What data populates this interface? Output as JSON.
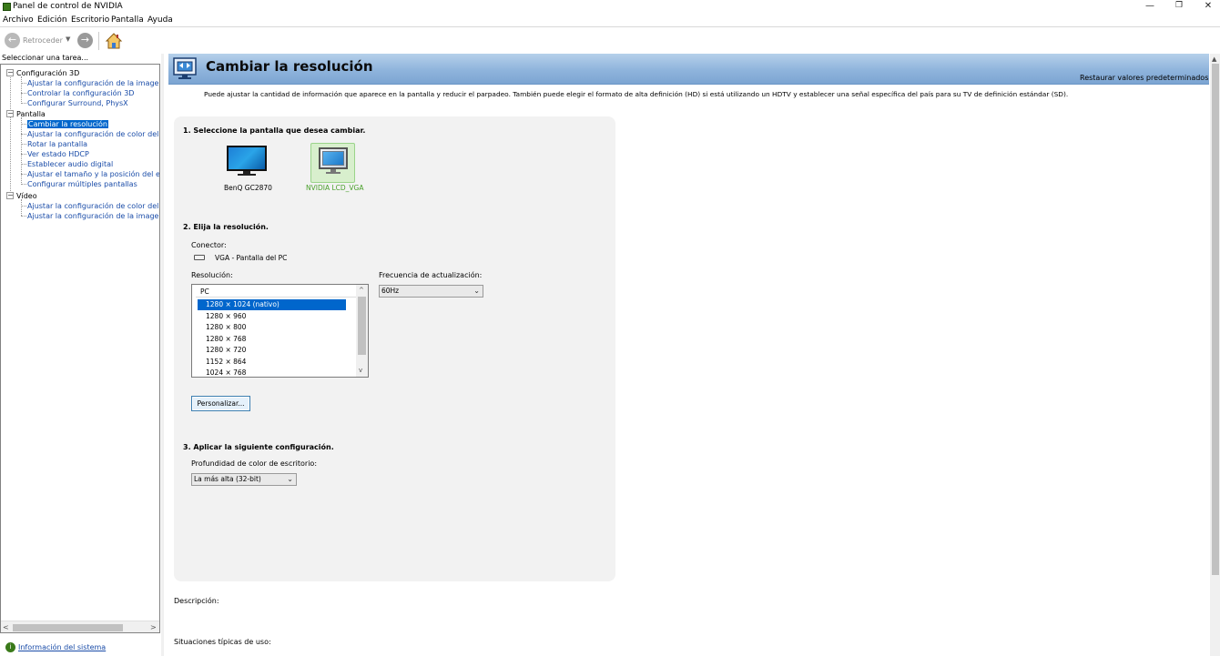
{
  "window": {
    "title": "Panel de control de NVIDIA",
    "minimize_glyph": "—",
    "maximize_glyph": "❐",
    "close_glyph": "✕"
  },
  "menu": [
    "Archivo",
    "Edición",
    "Escritorio",
    "Pantalla",
    "Ayuda"
  ],
  "toolbar": {
    "back_label": "Retroceder",
    "back_glyph": "←",
    "forward_glyph": "→",
    "dropdown_glyph": "▼"
  },
  "sidebar": {
    "header": "Seleccionar una tarea...",
    "categories": [
      {
        "label": "Configuración 3D",
        "items": [
          "Ajustar la configuración de la imagen con v",
          "Controlar la configuración 3D",
          "Configurar Surround, PhysX"
        ]
      },
      {
        "label": "Pantalla",
        "items": [
          "Cambiar la resolución",
          "Ajustar la configuración de color del escrito",
          "Rotar la pantalla",
          "Ver estado HDCP",
          "Establecer audio digital",
          "Ajustar el tamaño y la posición del escritori",
          "Configurar múltiples pantallas"
        ]
      },
      {
        "label": "Vídeo",
        "items": [
          "Ajustar la configuración de color del vídeo",
          "Ajustar la configuración de la imagen de víc"
        ]
      }
    ],
    "selected": "Cambiar la resolución",
    "expander_glyph": "−",
    "system_info_link": "Información del sistema",
    "scroll_left": "<",
    "scroll_right": ">"
  },
  "page": {
    "title": "Cambiar la resolución",
    "restore_defaults": "Restaurar valores predeterminados",
    "description": "Puede ajustar la cantidad de información que aparece en la pantalla y reducir el parpadeo. También puede elegir el formato de alta definición (HD) si está utilizando un HDTV y establecer una señal específica del país para su TV de definición estándar (SD).",
    "step1": {
      "title": "1. Seleccione la pantalla que desea cambiar.",
      "displays": [
        {
          "name": "BenQ GC2870",
          "selected": false
        },
        {
          "name": "NVIDIA LCD_VGA",
          "selected": true
        }
      ]
    },
    "step2": {
      "title": "2. Elija la resolución.",
      "connector_label": "Conector:",
      "connector_value": "VGA - Pantalla del PC",
      "resolution_label": "Resolución:",
      "resolution_group": "PC",
      "resolutions": [
        "1280 × 1024 (nativo)",
        "1280 × 960",
        "1280 × 800",
        "1280 × 768",
        "1280 × 720",
        "1152 × 864",
        "1024 × 768"
      ],
      "selected_resolution": "1280 × 1024 (nativo)",
      "refresh_label": "Frecuencia de actualización:",
      "refresh_value": "60Hz",
      "customize_button": "Personalizar...",
      "scroll_up": "^",
      "scroll_down": "v"
    },
    "step3": {
      "title": "3. Aplicar la siguiente configuración.",
      "color_depth_label": "Profundidad de color de escritorio:",
      "color_depth_value": "La más alta (32-bit)"
    },
    "dropdown_glyph": "⌄",
    "description_label": "Descripción:",
    "usage_label": "Situaciones típicas de uso:"
  },
  "colors": {
    "accent": "#0066cc",
    "nvidia_green": "#4aa02c",
    "link": "#1a4ca8",
    "banner": "#8fb4dc"
  }
}
